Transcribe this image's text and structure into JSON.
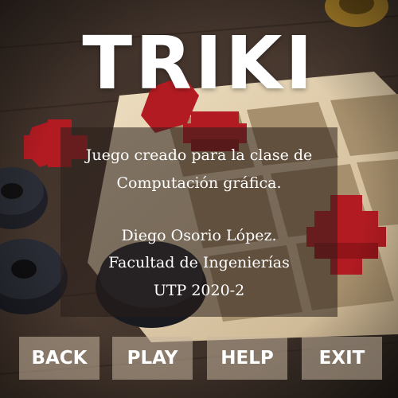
{
  "game": {
    "title": "TRIKI",
    "info": {
      "line1": "Juego creado para la clase de",
      "line2": "Computación gráfica.",
      "line3": "Diego Osorio López.",
      "line4": "Facultad de Ingenierías",
      "line5": "UTP 2020-2"
    },
    "menu": {
      "back": "BACK",
      "play": "PLAY",
      "help": "HELP",
      "exit": "EXIT"
    }
  },
  "colors": {
    "text": "#ffffff",
    "button_bg": "#c8b6a0",
    "panel_bg": "#281e19",
    "board_wood": "#e6d4b4",
    "red_piece": "#b81c22",
    "dark_piece": "#1e1f24"
  }
}
